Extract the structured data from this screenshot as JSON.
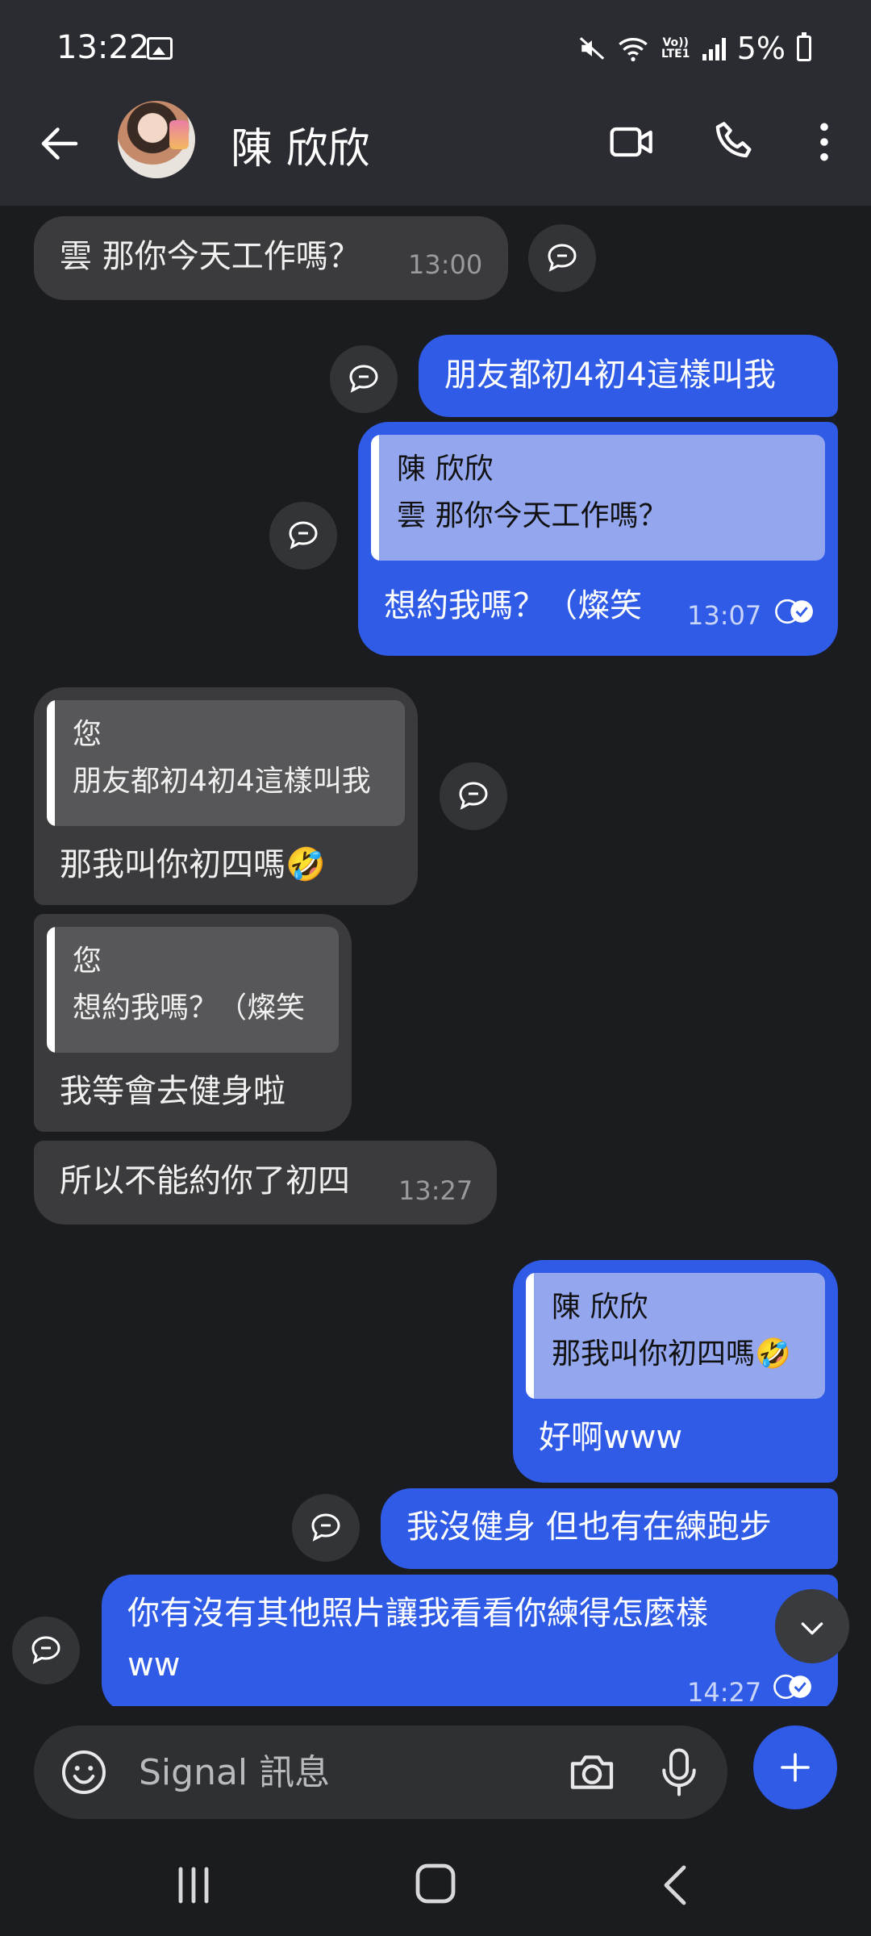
{
  "status_bar": {
    "time": "13:22",
    "network_label": "Vo)) LTE1",
    "battery": "5%"
  },
  "header": {
    "contact_name": "陳 欣欣"
  },
  "messages": {
    "m1": {
      "text": "雲 那你今天工作嗎？",
      "time": "13:00"
    },
    "m2": {
      "text": "朋友都初4初4這樣叫我"
    },
    "m3": {
      "quote_author": "陳 欣欣",
      "quote_text": "雲 那你今天工作嗎？",
      "text": "想約我嗎？（燦笑",
      "time": "13:07"
    },
    "m4": {
      "quote_author": "您",
      "quote_text": "朋友都初4初4這樣叫我",
      "text": "那我叫你初四嗎🤣"
    },
    "m5": {
      "quote_author": "您",
      "quote_text": "想約我嗎？（燦笑",
      "text": "我等會去健身啦"
    },
    "m6": {
      "text": "所以不能約你了初四",
      "time": "13:27"
    },
    "m7": {
      "quote_author": "陳 欣欣",
      "quote_text": "那我叫你初四嗎🤣",
      "text": "好啊www"
    },
    "m8": {
      "text": "我沒健身 但也有在練跑步"
    },
    "m9": {
      "line1": "你有沒有其他照片讓我看看你練得怎麼樣",
      "line2": "ww",
      "time": "14:27"
    }
  },
  "composer": {
    "placeholder": "Signal 訊息"
  },
  "colors": {
    "outgoing_bubble": "#2f5be6",
    "incoming_bubble": "#3b3b3d",
    "background": "#1b1c1f",
    "header": "#2a2c31"
  },
  "icons": [
    "back-arrow-icon",
    "video-call-icon",
    "phone-icon",
    "more-vert-icon",
    "reply-icon",
    "read-receipt-icon",
    "chevron-down-icon",
    "emoji-icon",
    "camera-icon",
    "mic-icon",
    "plus-icon",
    "nav-recents-icon",
    "nav-home-icon",
    "nav-back-icon"
  ]
}
